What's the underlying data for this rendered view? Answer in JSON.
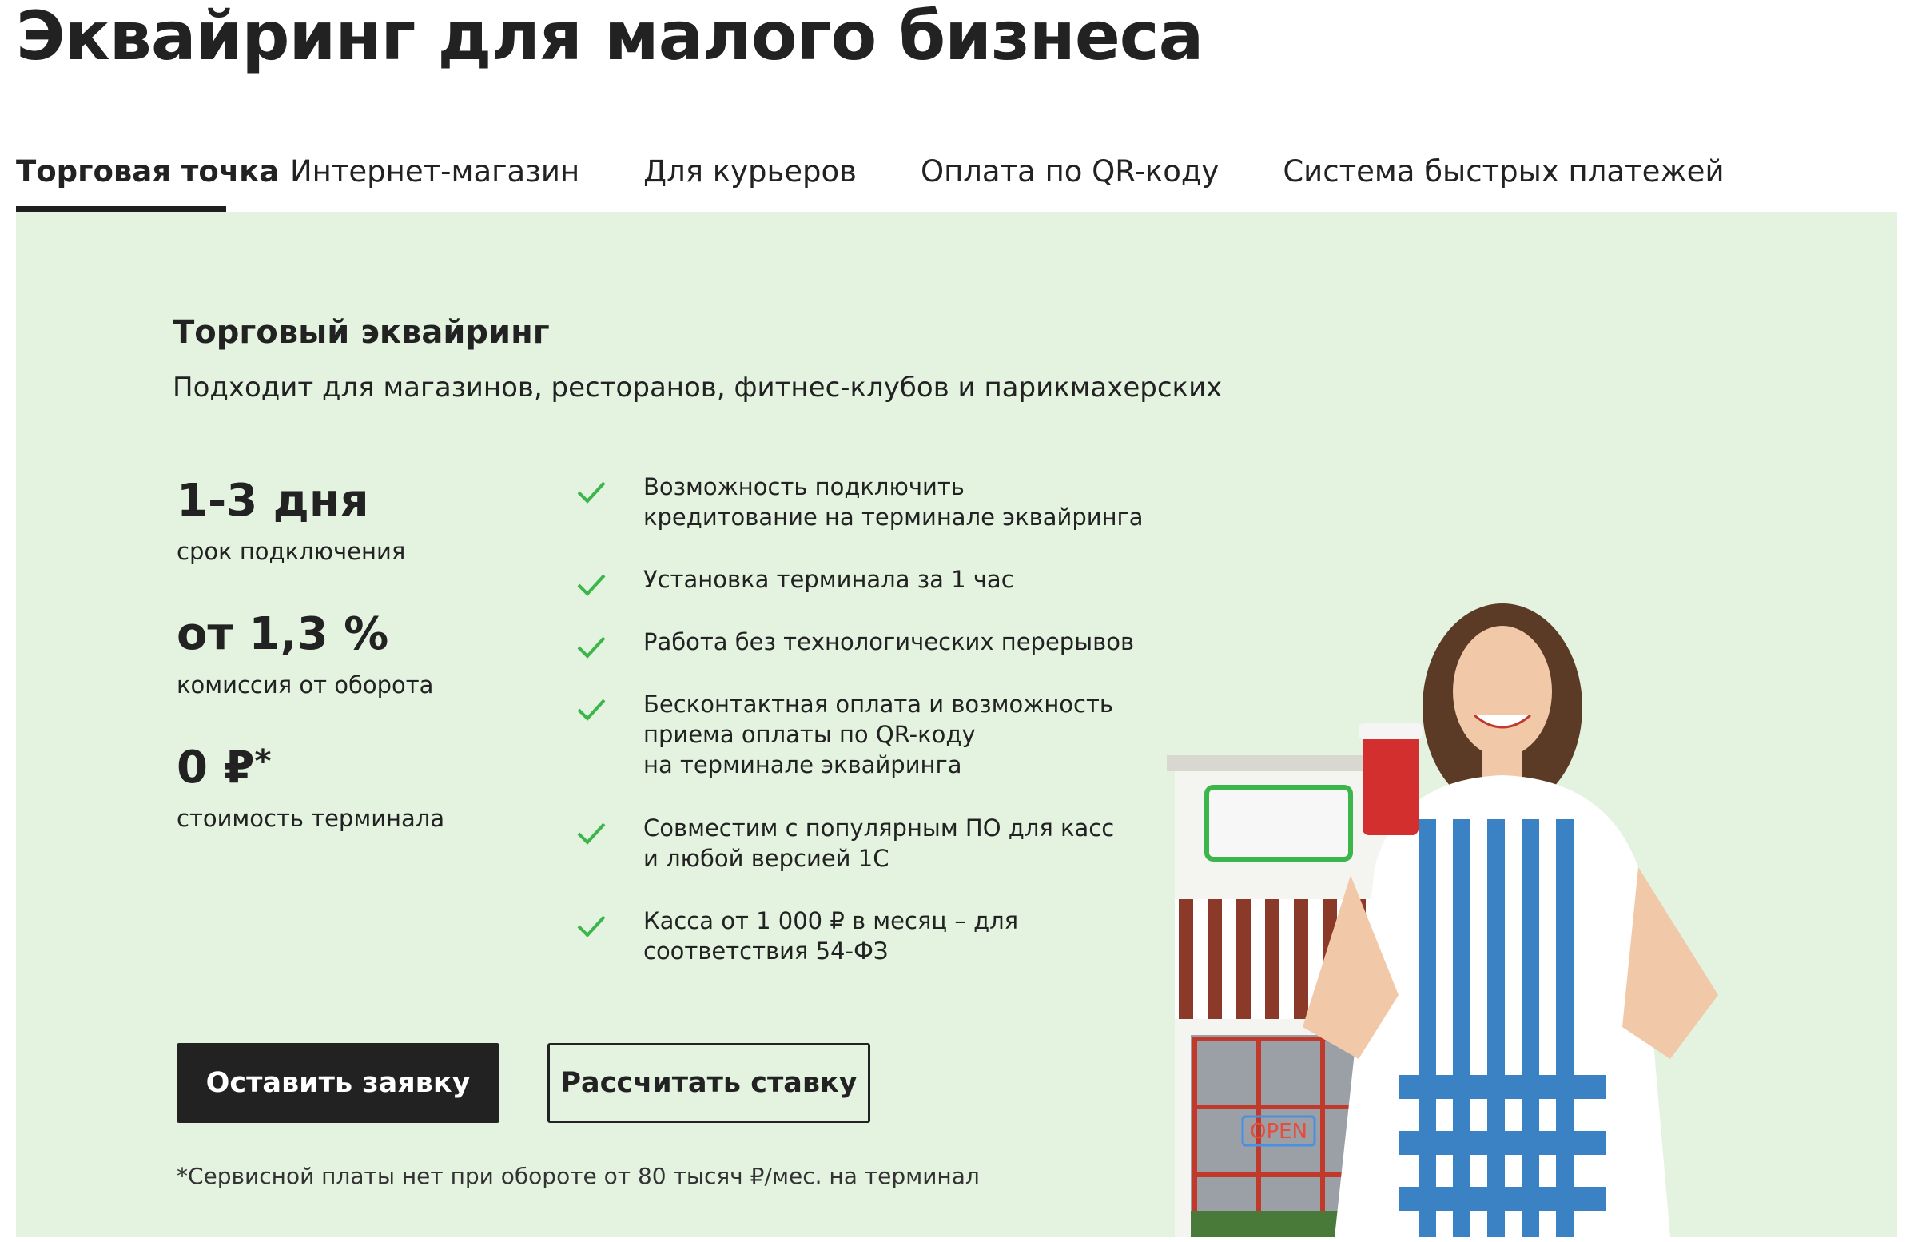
{
  "page": {
    "title": "Эквайринг для малого бизнеса"
  },
  "tabs": [
    {
      "label": "Торговая точка",
      "active": true
    },
    {
      "label": "Интернет-магазин",
      "active": false
    },
    {
      "label": "Для курьеров",
      "active": false
    },
    {
      "label": "Оплата по QR-коду",
      "active": false
    },
    {
      "label": "Система быстрых платежей",
      "active": false
    }
  ],
  "hero": {
    "title": "Торговый эквайринг",
    "subtitle": "Подходит для магазинов, ресторанов, фитнес-клубов и парикмахерских",
    "background_color": "#e3f3e0",
    "stats": [
      {
        "value": "1-3 дня",
        "label": "срок подключения"
      },
      {
        "value": "от 1,3 %",
        "label": "комиссия от оборота"
      },
      {
        "value": "0 ₽",
        "value_mark": "*",
        "label": "стоимость терминала"
      }
    ],
    "features": [
      {
        "icon": "check-icon",
        "line1": "Возможность подключить",
        "line2": "кредитование на терминале эквайринга"
      },
      {
        "icon": "check-icon",
        "line1": "Установка терминала за 1 час"
      },
      {
        "icon": "check-icon",
        "line1": "Работа без технологических перерывов"
      },
      {
        "icon": "check-icon",
        "line1": "Бесконтактная оплата и возможность",
        "line2": "приема оплаты по QR-коду",
        "line3": "на терминале эквайринга"
      },
      {
        "icon": "check-icon",
        "line1": "Совместим с популярным ПО для касс",
        "line2": "и любой версией 1С"
      },
      {
        "icon": "check-icon",
        "line1": "Касса от 1 000 ₽ в месяц – для",
        "line2": "соответствия 54-ФЗ"
      }
    ],
    "check_color": "#3cb54a",
    "buttons": {
      "primary": "Оставить заявку",
      "secondary": "Рассчитать ставку"
    },
    "footnote": "*Сервисной платы нет при обороте от 80 тысяч ₽/мес. на терминал",
    "illustration": {
      "sign_text": "OPEN"
    }
  }
}
